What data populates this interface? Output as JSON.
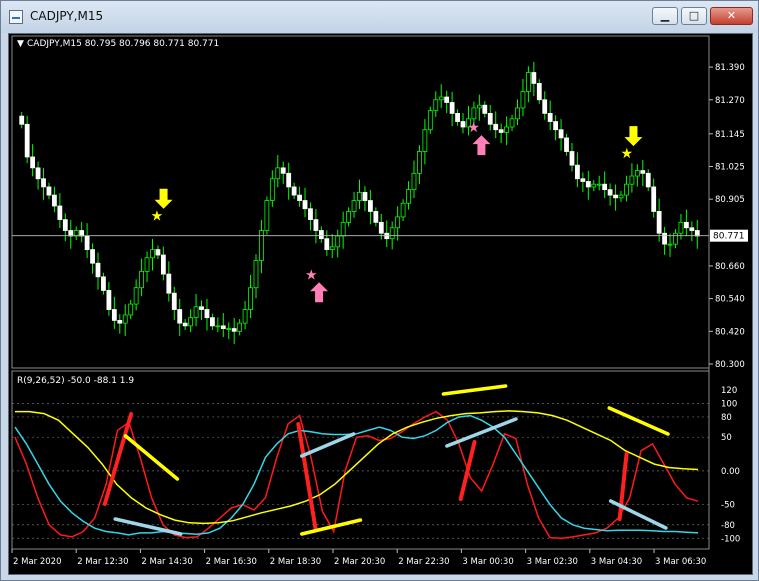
{
  "window": {
    "title": "CADJPY,M15",
    "minimize_glyph": "▁",
    "maximize_glyph": "□",
    "close_glyph": "✕"
  },
  "main_chart": {
    "header": "CADJPY,M15  80.795 80.796 80.771 80.771",
    "price_labels": [
      "81.390",
      "81.270",
      "81.145",
      "81.025",
      "80.905",
      "80.660",
      "80.540",
      "80.420",
      "80.300"
    ],
    "current_price": "80.771",
    "arrow_up_color": "#ff7fb6",
    "arrow_down_color": "#ffff00",
    "star_colors": [
      "#ffff00",
      "#ff7fb6"
    ]
  },
  "sub_chart": {
    "header": "R(9,26,52) -50.0 -88.1 1.9",
    "level_labels": [
      "120",
      "100",
      "80",
      "50",
      "0.00",
      "-50",
      "-80",
      "-100"
    ],
    "line_colors": {
      "fast": "#ff1a1a",
      "mid": "#33d6e6",
      "slow": "#ffff00"
    }
  },
  "time_axis": [
    "2 Mar 2020",
    "2 Mar 12:30",
    "2 Mar 14:30",
    "2 Mar 16:30",
    "2 Mar 18:30",
    "2 Mar 20:30",
    "2 Mar 22:30",
    "3 Mar 00:30",
    "3 Mar 02:30",
    "3 Mar 04:30",
    "3 Mar 06:30"
  ],
  "chart_data": {
    "type": "candlestick",
    "symbol": "CADJPY",
    "timeframe": "M15",
    "ylim": [
      80.3,
      81.46
    ],
    "ohlc_last": {
      "open": 80.795,
      "high": 80.796,
      "low": 80.771,
      "close": 80.771
    },
    "close_series": [
      81.18,
      81.06,
      81.02,
      80.98,
      80.95,
      80.92,
      80.88,
      80.83,
      80.79,
      80.77,
      80.79,
      80.77,
      80.72,
      80.67,
      80.62,
      80.57,
      80.5,
      80.46,
      80.45,
      80.48,
      80.52,
      80.58,
      80.64,
      80.69,
      80.72,
      80.7,
      80.63,
      80.56,
      80.5,
      80.45,
      80.44,
      80.47,
      80.51,
      80.5,
      80.47,
      80.44,
      80.44,
      80.43,
      80.43,
      80.42,
      80.45,
      80.5,
      80.58,
      80.68,
      80.79,
      80.9,
      80.98,
      81.02,
      81.0,
      80.95,
      80.92,
      80.9,
      80.87,
      80.83,
      80.79,
      80.76,
      80.72,
      80.73,
      80.77,
      80.82,
      80.86,
      80.9,
      80.93,
      80.9,
      80.86,
      80.82,
      80.78,
      80.76,
      80.8,
      80.84,
      80.89,
      80.94,
      81.0,
      81.08,
      81.16,
      81.23,
      81.27,
      81.28,
      81.26,
      81.22,
      81.19,
      81.17,
      81.2,
      81.24,
      81.25,
      81.22,
      81.18,
      81.16,
      81.15,
      81.17,
      81.2,
      81.24,
      81.3,
      81.37,
      81.33,
      81.27,
      81.22,
      81.19,
      81.16,
      81.13,
      81.08,
      81.03,
      80.98,
      80.97,
      80.95,
      80.96,
      80.96,
      80.94,
      80.92,
      80.91,
      80.92,
      80.96,
      80.99,
      81.01,
      81.0,
      80.95,
      80.86,
      80.78,
      80.74,
      80.74,
      80.78,
      80.82,
      80.8,
      80.79,
      80.77
    ],
    "annotations": [
      {
        "kind": "arrow-down",
        "price": 80.87
      },
      {
        "kind": "arrow-up",
        "price": 80.6
      },
      {
        "kind": "arrow-up",
        "price": 81.14
      },
      {
        "kind": "arrow-down",
        "price": 81.1
      }
    ],
    "indicator": {
      "name": "R(9,26,52)",
      "values": [
        -50.0,
        -88.1,
        1.9
      ],
      "ylim": [
        -110,
        120
      ],
      "levels": [
        100,
        80,
        50,
        0,
        -50,
        -80,
        -100
      ],
      "series": [
        {
          "name": "9",
          "values": [
            50,
            10,
            -40,
            -80,
            -95,
            -98,
            -90,
            -70,
            -20,
            60,
            72,
            20,
            -40,
            -80,
            -95,
            -99,
            -98,
            -85,
            -70,
            -55,
            -50,
            -58,
            -40,
            20,
            70,
            82,
            20,
            -60,
            -90,
            0,
            50,
            52,
            45,
            48,
            58,
            70,
            80,
            88,
            75,
            40,
            -10,
            -30,
            10,
            55,
            48,
            -20,
            -70,
            -99,
            -100,
            -98,
            -95,
            -92,
            -85,
            -70,
            -40,
            30,
            40,
            10,
            -20,
            -40,
            -45
          ]
        },
        {
          "name": "26",
          "values": [
            65,
            40,
            10,
            -20,
            -45,
            -62,
            -75,
            -85,
            -90,
            -92,
            -95,
            -92,
            -92,
            -90,
            -92,
            -93,
            -94,
            -92,
            -85,
            -70,
            -50,
            -20,
            20,
            40,
            55,
            60,
            58,
            55,
            54,
            54,
            55,
            60,
            65,
            60,
            50,
            48,
            52,
            60,
            72,
            80,
            82,
            75,
            65,
            50,
            25,
            0,
            -25,
            -50,
            -70,
            -80,
            -85,
            -87,
            -89,
            -88,
            -88,
            -88,
            -89,
            -90,
            -90,
            -91,
            -92
          ]
        },
        {
          "name": "52",
          "values": [
            88,
            88,
            85,
            75,
            55,
            35,
            10,
            -20,
            -40,
            -55,
            -65,
            -73,
            -77,
            -78,
            -77,
            -74,
            -68,
            -62,
            -57,
            -52,
            -45,
            -35,
            -20,
            0,
            20,
            40,
            55,
            65,
            72,
            78,
            82,
            85,
            86,
            88,
            89,
            88,
            86,
            82,
            75,
            65,
            55,
            45,
            30,
            20,
            10,
            5,
            3,
            2
          ]
        }
      ]
    }
  }
}
